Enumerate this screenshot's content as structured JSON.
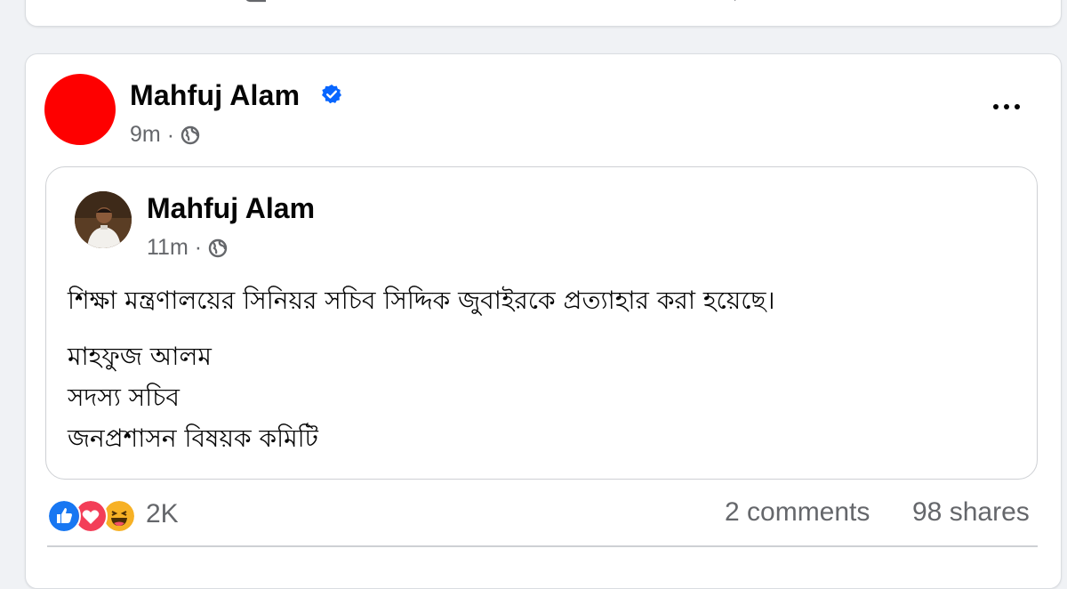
{
  "post": {
    "author": "Mahfuj Alam",
    "time": "9m",
    "separator": "·",
    "verified_icon": "verified-badge-icon",
    "privacy_icon": "globe-icon",
    "more_icon": "more-options-icon"
  },
  "shared_post": {
    "author": "Mahfuj Alam",
    "time": "11m",
    "separator": "·",
    "privacy_icon": "globe-icon",
    "text": "শিক্ষা মন্ত্রণালয়ের সিনিয়র সচিব সিদ্দিক জুবাইরকে প্রত্যাহার করা হয়েছে।",
    "signature": [
      "মাহফুজ আলম",
      "সদস্য সচিব",
      "জনপ্রশাসন বিষয়ক কমিটি"
    ]
  },
  "engagement": {
    "reactions": [
      "like-icon",
      "love-icon",
      "haha-icon"
    ],
    "reaction_count": "2K",
    "comments": "2 comments",
    "shares": "98 shares"
  },
  "colors": {
    "background": "#f0f2f5",
    "avatar_red": "#fe0000",
    "verified_blue": "#0866ff",
    "secondary_text": "#65676b"
  }
}
